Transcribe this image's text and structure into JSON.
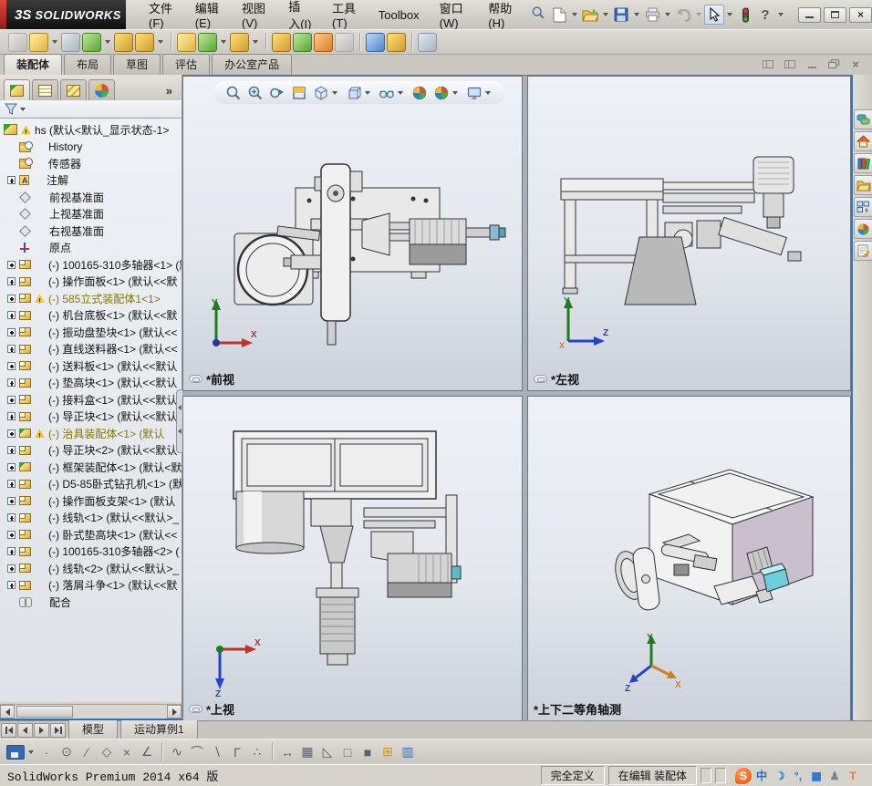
{
  "window": {
    "brand_mark": "3S",
    "brand": "SOLIDWORKS",
    "menus": [
      "文件(F)",
      "编辑(E)",
      "视图(V)",
      "插入(I)",
      "工具(T)",
      "Toolbox",
      "窗口(W)",
      "帮助(H)"
    ],
    "quick_access": [
      "search",
      "new-document",
      "open",
      "save",
      "print",
      "undo",
      "select",
      "performance-monitor",
      "help"
    ],
    "controls": [
      "minimize",
      "maximize",
      "close"
    ]
  },
  "assembly_toolbar": [
    {
      "name": "insert-components",
      "color": "c-grey"
    },
    {
      "name": "open-part",
      "color": "c-yellow",
      "caret": true
    },
    {
      "name": "mate",
      "color": "c-grey2"
    },
    {
      "name": "linear-component-pattern",
      "color": "c-green",
      "caret": true
    },
    {
      "name": "smart-fasteners",
      "color": "c-gold"
    },
    {
      "name": "move-component",
      "color": "c-gold",
      "caret": true,
      "sep_after": true
    },
    {
      "name": "show-hidden-components",
      "color": "c-yellow"
    },
    {
      "name": "assembly-features",
      "color": "c-green",
      "caret": true
    },
    {
      "name": "reference-geometry",
      "color": "c-gold",
      "caret": true,
      "sep_after": true
    },
    {
      "name": "new-motion-study",
      "color": "c-gold"
    },
    {
      "name": "bill-of-materials",
      "color": "c-green"
    },
    {
      "name": "exploded-view",
      "color": "c-orange"
    },
    {
      "name": "explode-line-sketch",
      "color": "c-grey",
      "sep_after": true
    },
    {
      "name": "instant-3d",
      "color": "c-blue"
    },
    {
      "name": "interference-detection",
      "color": "c-gold",
      "sep_after": true
    },
    {
      "name": "take-snapshot",
      "color": "c-grey2"
    }
  ],
  "command_tabs": [
    {
      "label": "装配体",
      "active": true
    },
    {
      "label": "布局"
    },
    {
      "label": "草图"
    },
    {
      "label": "评估"
    },
    {
      "label": "办公室产品"
    }
  ],
  "feature_panel": {
    "tabs": [
      "featuremanager",
      "propertymanager",
      "configurationmanager",
      "displaymanager"
    ],
    "overflow_label": "»",
    "root": {
      "label": "hs  (默认<默认_显示状态-1>",
      "warn": true
    },
    "items": [
      {
        "icon": "folder-history",
        "label": "History"
      },
      {
        "icon": "folder-sensor",
        "label": "传感器"
      },
      {
        "icon": "note",
        "label": "注解",
        "expand": true
      },
      {
        "icon": "plane",
        "label": "前视基准面"
      },
      {
        "icon": "plane",
        "label": "上视基准面"
      },
      {
        "icon": "plane",
        "label": "右视基准面"
      },
      {
        "icon": "origin",
        "label": "原点"
      },
      {
        "icon": "part",
        "label": "(-) 100165-310多轴器<1> (默",
        "expand": true
      },
      {
        "icon": "part",
        "label": "(-) 操作面板<1> (默认<<默",
        "expand": true
      },
      {
        "icon": "part",
        "label": "(-) 585立式装配体1<1>",
        "warn": true,
        "cls": "olive",
        "expand": true
      },
      {
        "icon": "part",
        "label": "(-) 机台底板<1> (默认<<默",
        "expand": true
      },
      {
        "icon": "part",
        "label": "(-) 振动盘垫块<1> (默认<<",
        "expand": true
      },
      {
        "icon": "part",
        "label": "(-) 直线送料器<1> (默认<<",
        "expand": true
      },
      {
        "icon": "part",
        "label": "(-) 送料板<1> (默认<<默认",
        "expand": true
      },
      {
        "icon": "part",
        "label": "(-) 垫高块<1> (默认<<默认",
        "expand": true
      },
      {
        "icon": "part",
        "label": "(-) 接料盒<1> (默认<<默认",
        "expand": true
      },
      {
        "icon": "part",
        "label": "(-) 导正块<1> (默认<<默认",
        "expand": true
      },
      {
        "icon": "asm",
        "label": "(-) 治具装配体<1> (默认",
        "warn": true,
        "cls": "olive",
        "expand": true
      },
      {
        "icon": "part",
        "label": "(-) 导正块<2> (默认<<默认",
        "expand": true
      },
      {
        "icon": "asm",
        "label": "(-) 框架装配体<1> (默认<默",
        "expand": true
      },
      {
        "icon": "part",
        "label": "(-) D5-85卧式钻孔机<1> (默",
        "expand": true
      },
      {
        "icon": "part",
        "label": "(-) 操作面板支架<1> (默认",
        "expand": true
      },
      {
        "icon": "part",
        "label": "(-) 线轨<1> (默认<<默认>_",
        "expand": true
      },
      {
        "icon": "part",
        "label": "(-) 卧式垫高块<1> (默认<<",
        "expand": true
      },
      {
        "icon": "part",
        "label": "(-) 100165-310多轴器<2> (",
        "expand": true
      },
      {
        "icon": "part",
        "label": "(-) 线轨<2> (默认<<默认>_",
        "expand": true
      },
      {
        "icon": "part",
        "label": "(-) 落屑斗争<1> (默认<<默",
        "expand": true
      },
      {
        "icon": "mate",
        "label": "配合"
      }
    ]
  },
  "graphics": {
    "headsup": [
      {
        "name": "zoom-to-fit",
        "glyph": "#g-mag"
      },
      {
        "name": "zoom-to-area",
        "glyph": "#g-magplus"
      },
      {
        "name": "previous-view",
        "glyph": "#g-magarrow"
      },
      {
        "name": "section-view",
        "glyph": "#g-section"
      },
      {
        "name": "view-orientation",
        "glyph": "#g-cubeiso",
        "caret": true
      },
      {
        "name": "display-style",
        "glyph": "#g-cube",
        "caret": true
      },
      {
        "name": "hide-show-items",
        "glyph": "#g-glasses",
        "caret": true
      },
      {
        "name": "edit-appearance",
        "glyph": "#g-ball"
      },
      {
        "name": "apply-scene",
        "glyph": "#g-ball",
        "caret": true
      },
      {
        "name": "view-settings",
        "glyph": "#g-monitor",
        "caret": true
      }
    ],
    "pane_controls": [
      "pane-split-left",
      "pane-split-right",
      "minimize-document",
      "restore-document",
      "close-document"
    ],
    "viewports": [
      {
        "label": "*前视",
        "chain": true,
        "axes": {
          "up": "Y",
          "right": "X"
        }
      },
      {
        "label": "*左视",
        "chain": true,
        "axes": {
          "up": "Y",
          "right": "Z",
          "origin": "X"
        }
      },
      {
        "label": "*上视",
        "chain": true,
        "axes": {
          "right": "X",
          "down": "Z"
        }
      },
      {
        "label": "*上下二等角轴测",
        "chain": false,
        "axes": {
          "up": "Y",
          "sw": "Z",
          "se": "X"
        }
      }
    ]
  },
  "task_pane_icons": [
    "forum",
    "resources-home",
    "design-library",
    "file-explorer",
    "view-palette",
    "appearances-scenes",
    "custom-properties"
  ],
  "model_tabs": [
    {
      "label": "模型",
      "active": true
    },
    {
      "label": "运动算例1"
    }
  ],
  "sketch_toolbar": [
    {
      "name": "save",
      "cls": "ik-disk",
      "caret": true
    },
    {
      "name": "point-tool",
      "glyph": "·"
    },
    {
      "name": "circle-tool",
      "glyph": "⊙"
    },
    {
      "name": "line-tool",
      "glyph": "∕"
    },
    {
      "name": "polygon-tool",
      "glyph": "◇"
    },
    {
      "name": "trim-entities",
      "glyph": "×"
    },
    {
      "name": "sketch-chamfer",
      "glyph": "∠",
      "sep_after": true
    },
    {
      "name": "spline-tool",
      "glyph": "∿"
    },
    {
      "name": "tangent-arc",
      "glyph": "⌒"
    },
    {
      "name": "mirror-entities",
      "glyph": "∖"
    },
    {
      "name": "corner-rectangle",
      "glyph": "Γ"
    },
    {
      "name": "sketch-points",
      "glyph": "∴",
      "sep_after": true
    },
    {
      "name": "smart-dimension",
      "glyph": "↔"
    },
    {
      "name": "grid-snap",
      "glyph": "▦"
    },
    {
      "name": "angle-snap",
      "glyph": "◺"
    },
    {
      "name": "wireframe-view",
      "glyph": "□"
    },
    {
      "name": "shaded-view",
      "glyph": "■",
      "pressed": true
    },
    {
      "name": "measure-tool",
      "glyph": "⊞",
      "cls2": "gold"
    },
    {
      "name": "split-viewport",
      "glyph": "▥",
      "cls2": "blue"
    }
  ],
  "statusbar": {
    "left_text": "SolidWorks Premium 2014 x64 版",
    "define_state": "完全定义",
    "edit_state": "在编辑  装配体",
    "tray": [
      {
        "name": "ime-sogou",
        "glyph": "S",
        "cls": "sogou"
      },
      {
        "name": "ime-mode-chinese",
        "glyph": "中",
        "cls": "bluetxt"
      },
      {
        "name": "ime-halfmoon",
        "glyph": "☽",
        "cls": "bluetxt"
      },
      {
        "name": "ime-punctuation",
        "glyph": "°,",
        "cls": "bluetxt"
      },
      {
        "name": "ime-keyboard",
        "glyph": "▦",
        "cls": "bluetxt"
      },
      {
        "name": "ime-toolbox",
        "glyph": "♟",
        "cls": "greytxt"
      },
      {
        "name": "ime-skin",
        "glyph": "T",
        "cls": "orangetxt"
      }
    ]
  }
}
